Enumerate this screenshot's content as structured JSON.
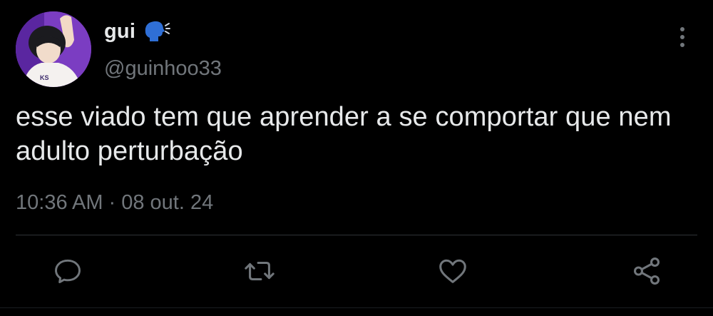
{
  "user": {
    "display_name": "gui",
    "name_emoji": "speaking-head-emoji",
    "handle": "@guinhoo33",
    "avatar": "profile-photo"
  },
  "tweet": {
    "text": "esse viado tem que aprender a se comportar que nem adulto perturbação",
    "time": "10:36 AM",
    "separator": "·",
    "date": "08 out. 24"
  },
  "actions": {
    "reply_icon": "reply-icon",
    "retweet_icon": "retweet-icon",
    "like_icon": "heart-icon",
    "share_icon": "share-icon",
    "more_icon": "more-vertical-icon"
  },
  "colors": {
    "background": "#000000",
    "primary_text": "#e7e9ea",
    "secondary_text": "#71767b",
    "divider": "#2f3336",
    "emoji_blue": "#2f6fd6"
  }
}
